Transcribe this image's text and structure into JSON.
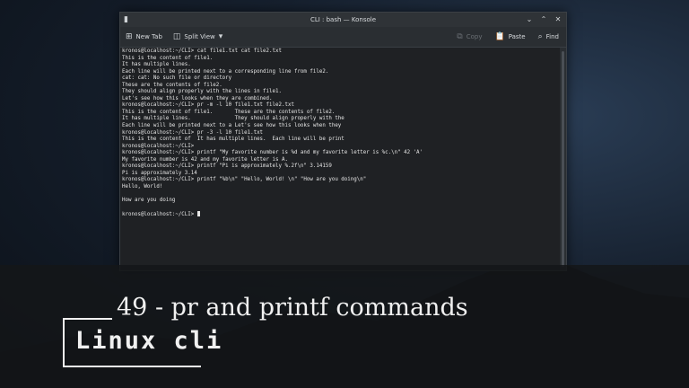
{
  "window": {
    "title": "CLI : bash — Konsole",
    "controls": {
      "minimize": "⌄",
      "maximize": "⌃",
      "close": "✕"
    }
  },
  "toolbar": {
    "new_tab": "New Tab",
    "split_view": "Split View",
    "copy": "Copy",
    "paste": "Paste",
    "find": "Find"
  },
  "terminal": {
    "lines": [
      "kronos@localhost:~/CLI> cat file1.txt cat file2.txt",
      "This is the content of file1.",
      "It has multiple lines.",
      "Each line will be printed next to a corresponding line from file2.",
      "cat: cat: No such file or directory",
      "These are the contents of file2.",
      "They should align properly with the lines in file1.",
      "Let's see how this looks when they are combined.",
      "kronos@localhost:~/CLI> pr -m -l 10 file1.txt file2.txt",
      "This is the content of file1.       These are the contents of file2.",
      "It has multiple lines.              They should align properly with the",
      "Each line will be printed next to a Let's see how this looks when they",
      "kronos@localhost:~/CLI> pr -3 -l 10 file1.txt",
      "This is the content of  It has multiple lines.  Each line will be print",
      "kronos@localhost:~/CLI>",
      "kronos@localhost:~/CLI> printf \"My favorite number is %d and my favorite letter is %c.\\n\" 42 'A'",
      "My favorite number is 42 and my favorite letter is A.",
      "kronos@localhost:~/CLI> printf \"Pi is approximately %.2f\\n\" 3.14159",
      "Pi is approximately 3.14",
      "kronos@localhost:~/CLI> printf \"%b\\n\" \"Hello, World! \\n\" \"How are you doing\\n\"",
      "Hello, World!",
      "",
      "How are you doing",
      "",
      "kronos@localhost:~/CLI> "
    ]
  },
  "banner": {
    "title": "49 - pr and printf commands",
    "brand": "Linux cli"
  },
  "colors": {
    "terminal_bg": "#1f2124",
    "terminal_fg": "#e6e6e6",
    "window_chrome": "#2f3337"
  }
}
